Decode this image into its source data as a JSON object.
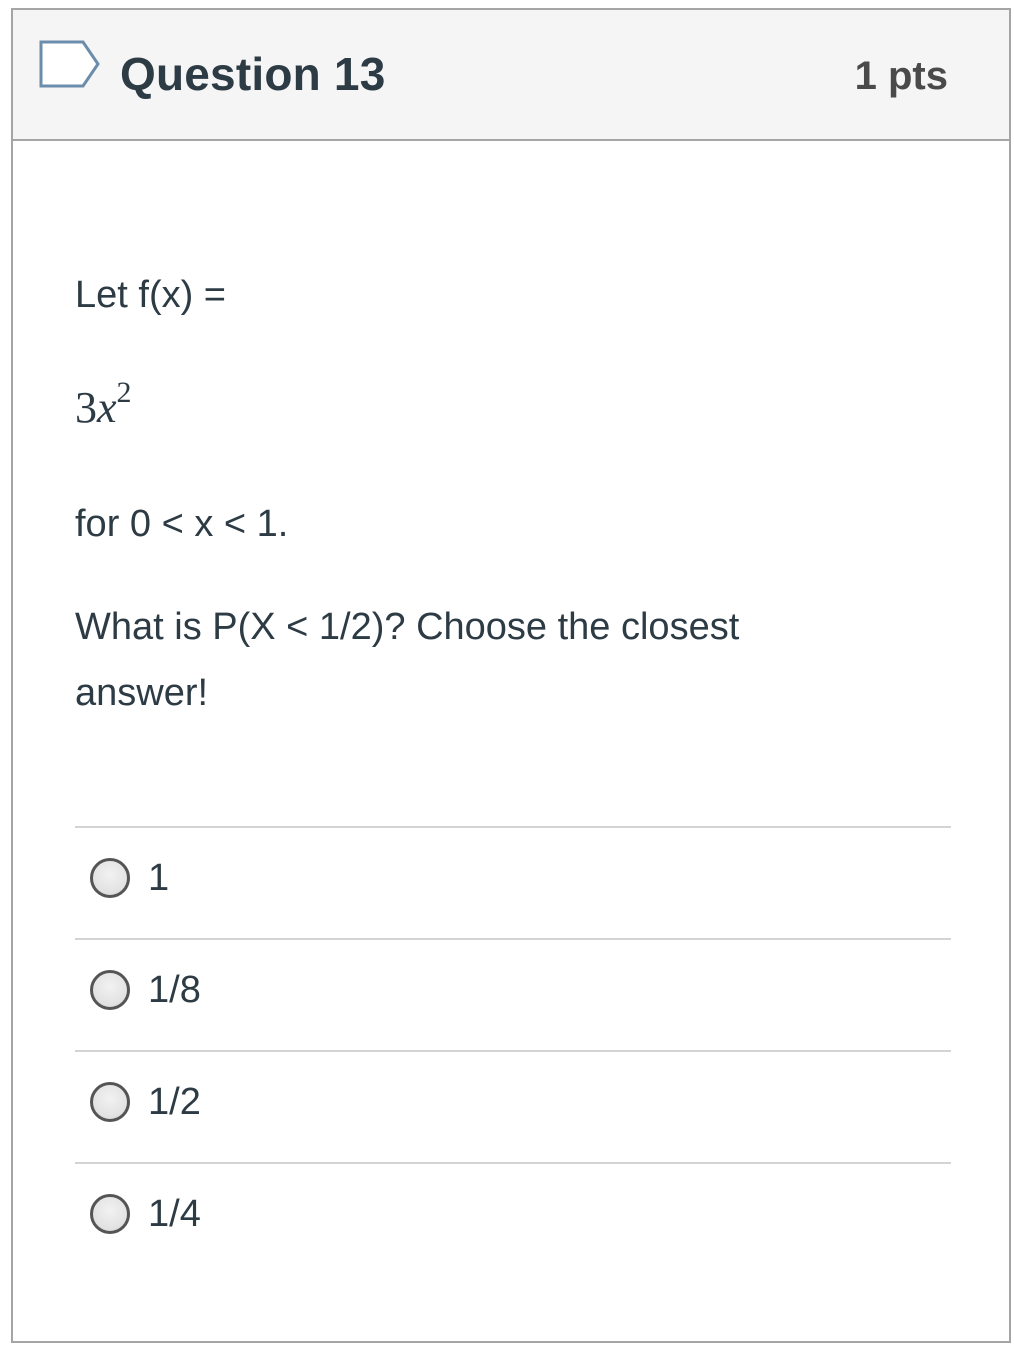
{
  "header": {
    "title": "Question 13",
    "points": "1 pts",
    "flag_icon": "bookmark-flag-icon"
  },
  "question": {
    "line1": "Let f(x) =",
    "math_coefficient": "3",
    "math_variable": "x",
    "math_exponent": "2",
    "line3": "for 0 < x < 1.",
    "line4": "What is P(X < 1/2)?  Choose the closest answer!"
  },
  "answers": [
    {
      "label": "1",
      "selected": false
    },
    {
      "label": "1/8",
      "selected": false
    },
    {
      "label": "1/2",
      "selected": false
    },
    {
      "label": "1/4",
      "selected": false
    }
  ],
  "colors": {
    "header_bg": "#f5f5f5",
    "border": "#a5a5a5",
    "text": "#2d3b45",
    "flag_outline": "#6b8caa"
  }
}
